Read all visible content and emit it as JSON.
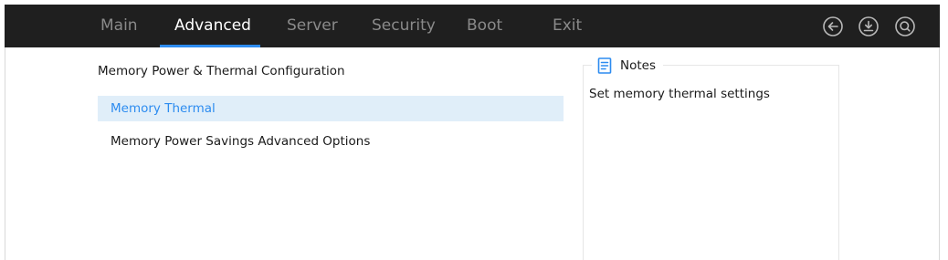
{
  "nav": {
    "tabs": [
      {
        "label": "Main",
        "active": false
      },
      {
        "label": "Advanced",
        "active": true
      },
      {
        "label": "Server",
        "active": false
      },
      {
        "label": "Security",
        "active": false
      },
      {
        "label": "Boot",
        "active": false
      },
      {
        "label": "Exit",
        "active": false
      }
    ],
    "icons": [
      "back-icon",
      "save-icon",
      "search-icon"
    ]
  },
  "main": {
    "section_title": "Memory Power & Thermal Configuration",
    "items": [
      {
        "label": "Memory Thermal",
        "selected": true
      },
      {
        "label": "Memory Power Savings Advanced Options",
        "selected": false
      }
    ]
  },
  "notes": {
    "title": "Notes",
    "text": "Set memory thermal settings"
  },
  "colors": {
    "topbar_bg": "#1f1f1f",
    "accent": "#2d8cf0",
    "selected_bg": "#e0eef9"
  }
}
